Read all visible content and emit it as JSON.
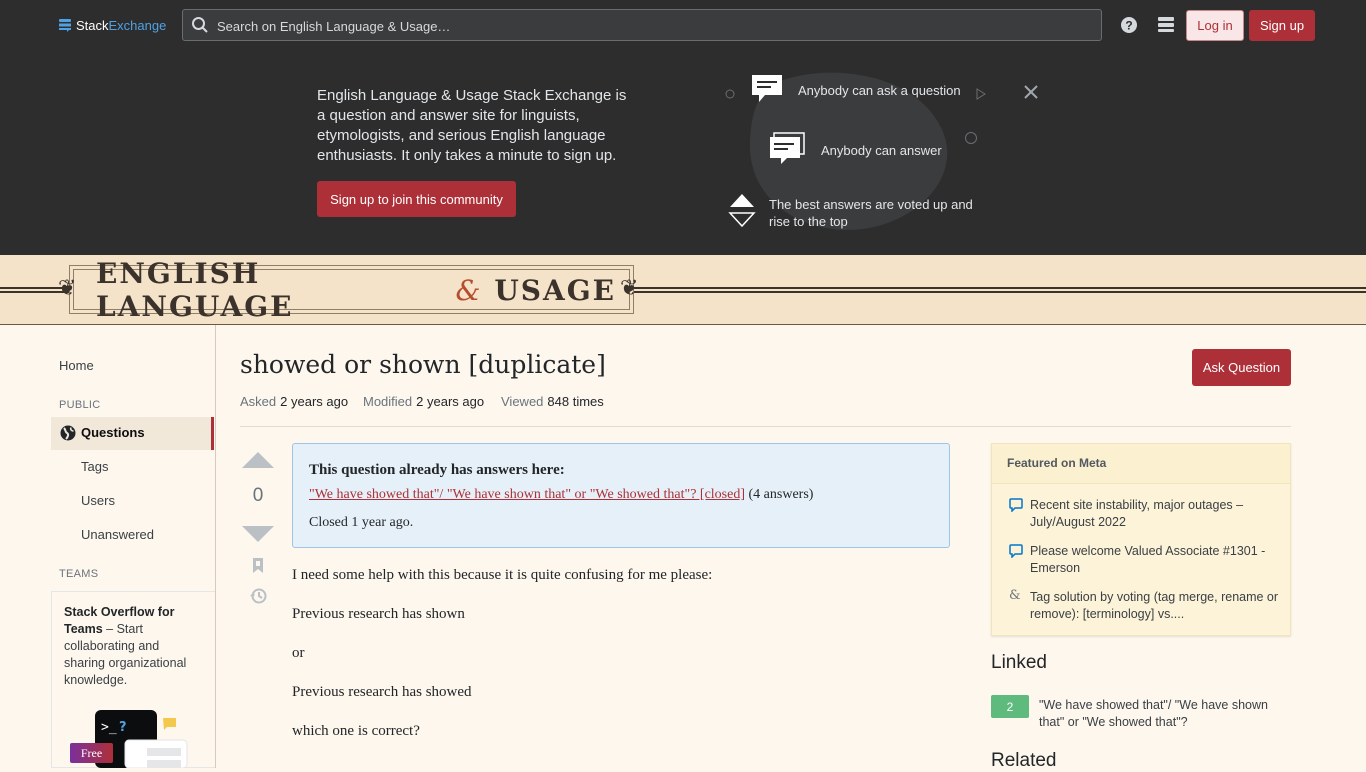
{
  "topbar": {
    "logo_stack": "Stack",
    "logo_exchange": "Exchange",
    "search_placeholder": "Search on English Language & Usage…",
    "login_label": "Log in",
    "signup_label": "Sign up"
  },
  "hero": {
    "text": "English Language & Usage Stack Exchange is a question and answer site for linguists, etymologists, and serious English language enthusiasts. It only takes a minute to sign up.",
    "join_label": "Sign up to join this community",
    "features": [
      {
        "label": "Anybody can ask a question"
      },
      {
        "label": "Anybody can answer"
      },
      {
        "label": "The best answers are voted up and rise to the top"
      }
    ]
  },
  "banner": {
    "title_left": "ENGLISH LANGUAGE",
    "title_amp": "&",
    "title_right": "USAGE"
  },
  "nav": {
    "home": "Home",
    "public_heading": "PUBLIC",
    "questions": "Questions",
    "tags": "Tags",
    "users": "Users",
    "unanswered": "Unanswered",
    "teams_heading": "TEAMS",
    "teams_title": "Stack Overflow for Teams",
    "teams_text": " – Start collaborating and sharing organizational knowledge.",
    "free_badge": "Free"
  },
  "question": {
    "title": "showed or shown [duplicate]",
    "ask_label": "Ask Question",
    "asked_label": "Asked",
    "asked_value": "2 years ago",
    "modified_label": "Modified",
    "modified_value": "2 years ago",
    "viewed_label": "Viewed",
    "viewed_value": "848 times",
    "votes": "0",
    "notice_heading": "This question already has answers here:",
    "notice_link": "\"We have showed that\"/ \"We have shown that\" or \"We showed that\"? [closed]",
    "notice_count": "(4 answers)",
    "closed_label": "Closed",
    "closed_time": "1 year ago",
    "body": [
      "I need some help with this because it is quite confusing for me please:",
      "Previous research has shown",
      "or",
      "Previous research has showed",
      "which one is correct?"
    ]
  },
  "sidebar": {
    "meta_heading": "Featured on Meta",
    "meta_items": [
      {
        "text": "Recent site instability, major outages – July/August 2022",
        "icon": "speech-bubble-icon"
      },
      {
        "text": "Please welcome Valued Associate #1301 - Emerson",
        "icon": "speech-bubble-icon"
      },
      {
        "text": "Tag solution by voting (tag merge, rename or remove): [terminology] vs....",
        "icon": "stack-logo-icon"
      }
    ],
    "linked_heading": "Linked",
    "linked_score": "2",
    "linked_text": "\"We have showed that\"/ \"We have shown that\" or \"We showed that\"?",
    "related_heading": "Related"
  },
  "colors": {
    "accent": "#ad3038",
    "topbar_bg": "#2d2d2e",
    "banner_bg": "#f4e2c9",
    "page_bg": "#fdf7ee",
    "link_blue": "#4fa1e3",
    "score_green": "#5eba7d"
  }
}
